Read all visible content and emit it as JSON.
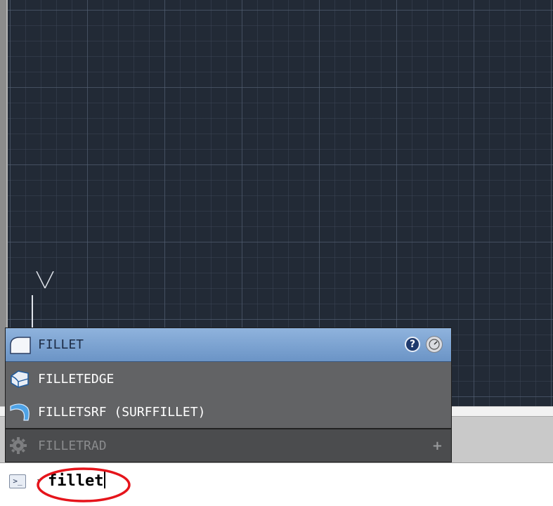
{
  "canvas": {
    "ucs_axis_label": "Y",
    "background_color": "#222a36"
  },
  "autocomplete": {
    "items": [
      {
        "label": "FILLET",
        "icon": "fillet-icon",
        "selected": true
      },
      {
        "label": "FILLETEDGE",
        "icon": "filletedge-icon",
        "selected": false
      },
      {
        "label": "FILLETSRF (SURFFILLET)",
        "icon": "filletsrf-icon",
        "selected": false
      },
      {
        "label": "FILLETRAD",
        "icon": "gear-icon",
        "selected": false,
        "disabled": true
      }
    ],
    "help_icon_glyph": "?",
    "expand_glyph": "+",
    "selected_color": "#7ea4d2"
  },
  "command_line": {
    "input_value": "fillet",
    "prompt_glyph": ">_",
    "highlight_color": "#e5141b"
  }
}
